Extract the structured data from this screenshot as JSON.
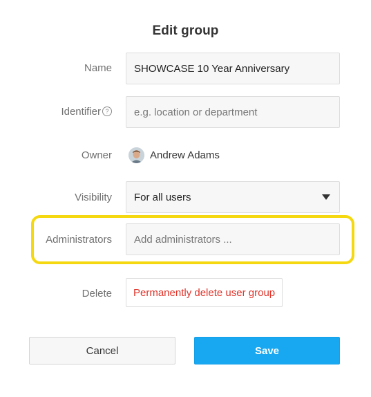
{
  "dialog": {
    "title": "Edit group"
  },
  "form": {
    "name": {
      "label": "Name",
      "value": "SHOWCASE 10 Year Anniversary"
    },
    "identifier": {
      "label": "Identifier",
      "placeholder": "e.g. location or department",
      "help_icon": "question-circle-icon"
    },
    "owner": {
      "label": "Owner",
      "name": "Andrew Adams"
    },
    "visibility": {
      "label": "Visibility",
      "selected": "For all users"
    },
    "administrators": {
      "label": "Administrators",
      "placeholder": "Add administrators ...",
      "highlight_color": "#f5d80f"
    },
    "delete": {
      "label": "Delete",
      "button_label": "Permanently delete user group",
      "color": "#e0342a"
    }
  },
  "actions": {
    "cancel_label": "Cancel",
    "save_label": "Save",
    "save_color": "#18a8f1"
  }
}
